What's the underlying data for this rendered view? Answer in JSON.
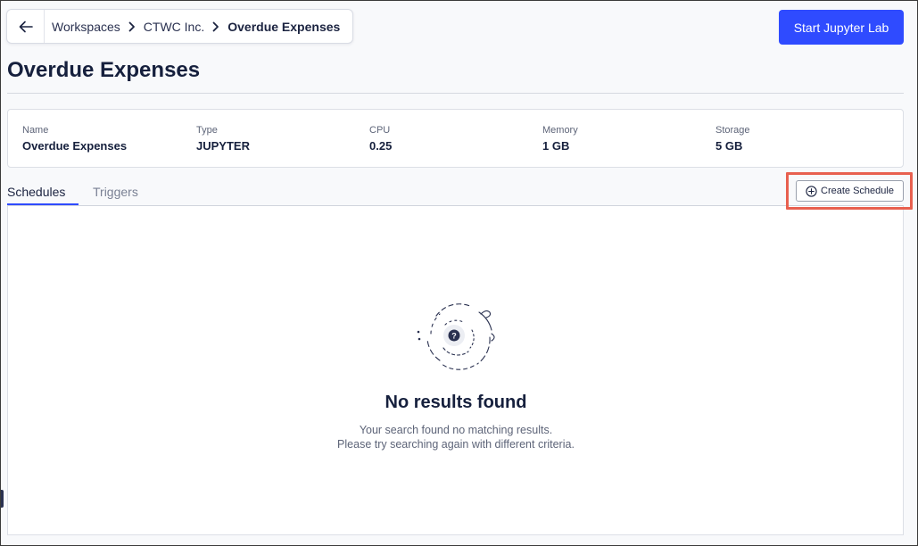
{
  "breadcrumb": {
    "items": [
      "Workspaces",
      "CTWC Inc.",
      "Overdue Expenses"
    ]
  },
  "header": {
    "start_button_label": "Start Jupyter Lab",
    "title": "Overdue Expenses"
  },
  "info": {
    "fields": [
      {
        "label": "Name",
        "value": "Overdue Expenses"
      },
      {
        "label": "Type",
        "value": "JUPYTER"
      },
      {
        "label": "CPU",
        "value": "0.25"
      },
      {
        "label": "Memory",
        "value": "1 GB"
      },
      {
        "label": "Storage",
        "value": "5 GB"
      }
    ]
  },
  "tabs": [
    {
      "label": "Schedules",
      "active": true
    },
    {
      "label": "Triggers",
      "active": false
    }
  ],
  "actions": {
    "create_schedule_label": "Create Schedule"
  },
  "empty_state": {
    "title": "No results found",
    "line1": "Your search found no matching results.",
    "line2": "Please try searching again with different criteria."
  },
  "colors": {
    "accent": "#2f4bff",
    "highlight": "#e8604f",
    "text": "#16203d"
  },
  "icons": [
    "arrow-left-icon",
    "chevron-right-icon",
    "plus-circle-icon",
    "question-icon"
  ]
}
